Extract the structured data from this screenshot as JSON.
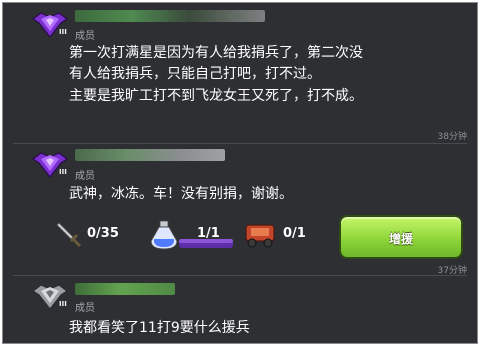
{
  "messages": [
    {
      "role": "成员",
      "level": "III",
      "lines": [
        "第一次打满星是因为有人给我捐兵了，第二次没",
        "有人给我捐兵，只能自己打吧，打不过。",
        "主要是我旷工打不到飞龙女王又死了，打不成。"
      ],
      "time": "38分钟"
    },
    {
      "role": "成员",
      "level": "III",
      "lines": [
        "武神，冰冻。车！没有别捐，谢谢。"
      ],
      "resources": [
        {
          "icon": "sword-icon",
          "value": "0/35"
        },
        {
          "icon": "spell-bottle-icon",
          "value": "1/1"
        },
        {
          "icon": "siege-machine-icon",
          "value": "0/1"
        }
      ],
      "donate_button": "增援",
      "time": "37分钟"
    },
    {
      "role": "成员",
      "level": "III",
      "lines": [
        "我都看笑了11打9要什么援兵"
      ]
    }
  ],
  "colors": {
    "background": "#2d2f33",
    "text": "#ffffff",
    "role_text": "#a6a9ad",
    "time_text": "#8c8f94",
    "button_green": "#8fd63a",
    "league_purple": "#7a2fd0",
    "league_silver": "#9a9ea4"
  }
}
